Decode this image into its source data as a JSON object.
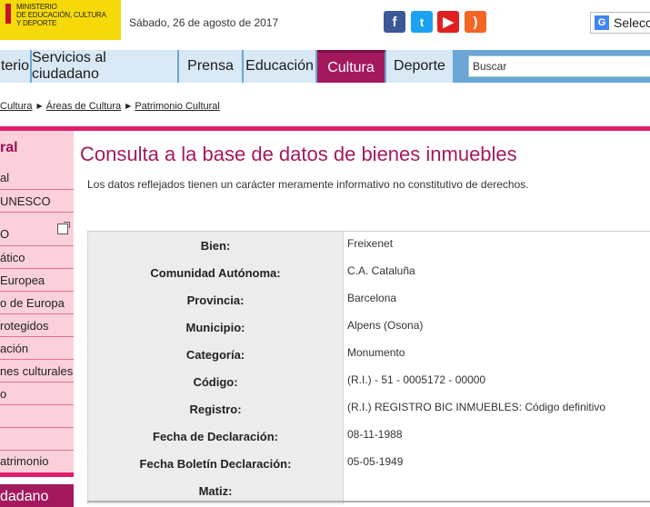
{
  "header": {
    "logo_text": "MINISTERIO\nDE EDUCACIÓN, CULTURA\nY DEPORTE",
    "date": "Sábado, 26 de agosto de 2017",
    "translate_label": "Selecc",
    "social": [
      {
        "icon": "facebook-icon",
        "glyph": "f"
      },
      {
        "icon": "twitter-icon",
        "glyph": "t"
      },
      {
        "icon": "youtube-icon",
        "glyph": "▶"
      },
      {
        "icon": "rss-icon",
        "glyph": ")"
      }
    ]
  },
  "nav": {
    "items": [
      "terio",
      "Servicios al ciudadano",
      "Prensa",
      "Educación",
      "Cultura",
      "Deporte"
    ],
    "active": "Cultura",
    "search_value": "Buscar"
  },
  "breadcrumb": {
    "items": [
      "Cultura",
      "Áreas de Cultura",
      "Patrimonio Cultural"
    ]
  },
  "sidebar": {
    "title": "ral",
    "items": [
      "al",
      " UNESCO",
      "O",
      "ático",
      "Europea",
      "o de Europa",
      "rotegidos",
      "ación",
      "nes culturales",
      "o",
      "",
      "atrimonio"
    ],
    "bottom_block": "dadano"
  },
  "main": {
    "title": "Consulta a la base de datos de bienes inmuebles",
    "disclaimer": "Los datos reflejados tienen un carácter meramente informativo no constitutivo de derechos.",
    "rows": [
      {
        "label": "Bien:",
        "value": "Freixenet"
      },
      {
        "label": "Comunidad Autónoma:",
        "value": "C.A. Cataluña"
      },
      {
        "label": "Provincia:",
        "value": "Barcelona"
      },
      {
        "label": "Municipio:",
        "value": "Alpens (Osona)"
      },
      {
        "label": "Categoría:",
        "value": "Monumento"
      },
      {
        "label": "Código:",
        "value": "(R.I.) - 51 - 0005172 - 00000"
      },
      {
        "label": "Registro:",
        "value": "(R.I.) REGISTRO BIC INMUEBLES: Código definitivo"
      },
      {
        "label": "Fecha de Declaración:",
        "value": "08-11-1988"
      },
      {
        "label": "Fecha Boletín Declaración:",
        "value": "05-05-1949"
      },
      {
        "label": "Matiz:",
        "value": ""
      }
    ]
  },
  "colors": {
    "accent": "#a4195d",
    "rule": "#e11d6b",
    "nav_bg": "#d9e8f5",
    "sidebar_bg": "#fbd0da"
  }
}
